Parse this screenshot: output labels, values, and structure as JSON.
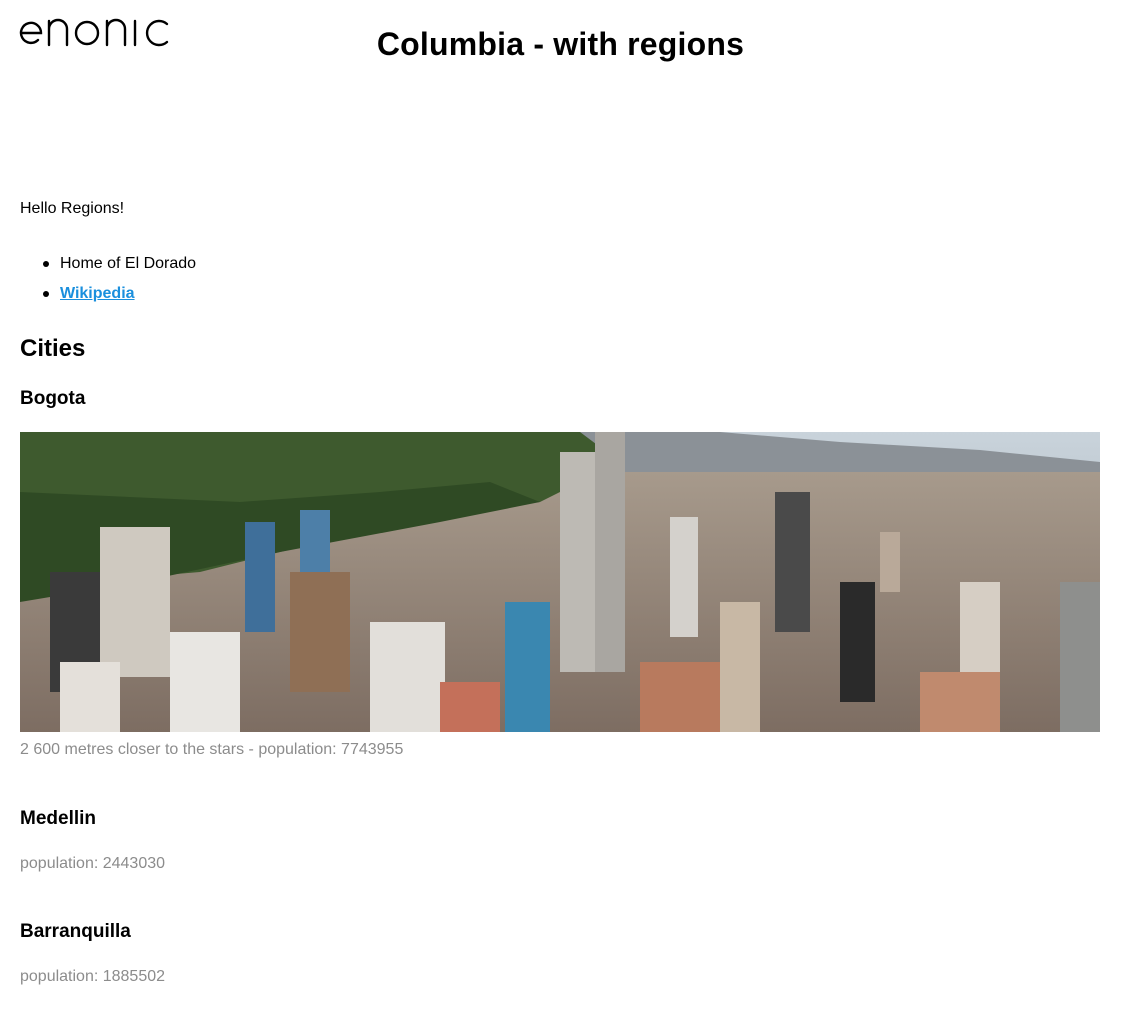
{
  "header": {
    "logo_text": "enonic",
    "title": "Columbia - with regions"
  },
  "main": {
    "intro": "Hello Regions!",
    "links": [
      {
        "label": "Home of El Dorado",
        "is_link": false
      },
      {
        "label": "Wikipedia",
        "is_link": true
      }
    ],
    "cities_heading": "Cities",
    "cities": [
      {
        "name": "Bogota",
        "caption": "2 600 metres closer to the stars - population: 7743955",
        "has_image": true
      },
      {
        "name": "Medellin",
        "caption": "population: 2443030",
        "has_image": false
      },
      {
        "name": "Barranquilla",
        "caption": "population: 1885502",
        "has_image": false
      }
    ]
  },
  "colors": {
    "link": "#1a8fdd",
    "caption": "#8c8c8c",
    "text": "#000000"
  }
}
